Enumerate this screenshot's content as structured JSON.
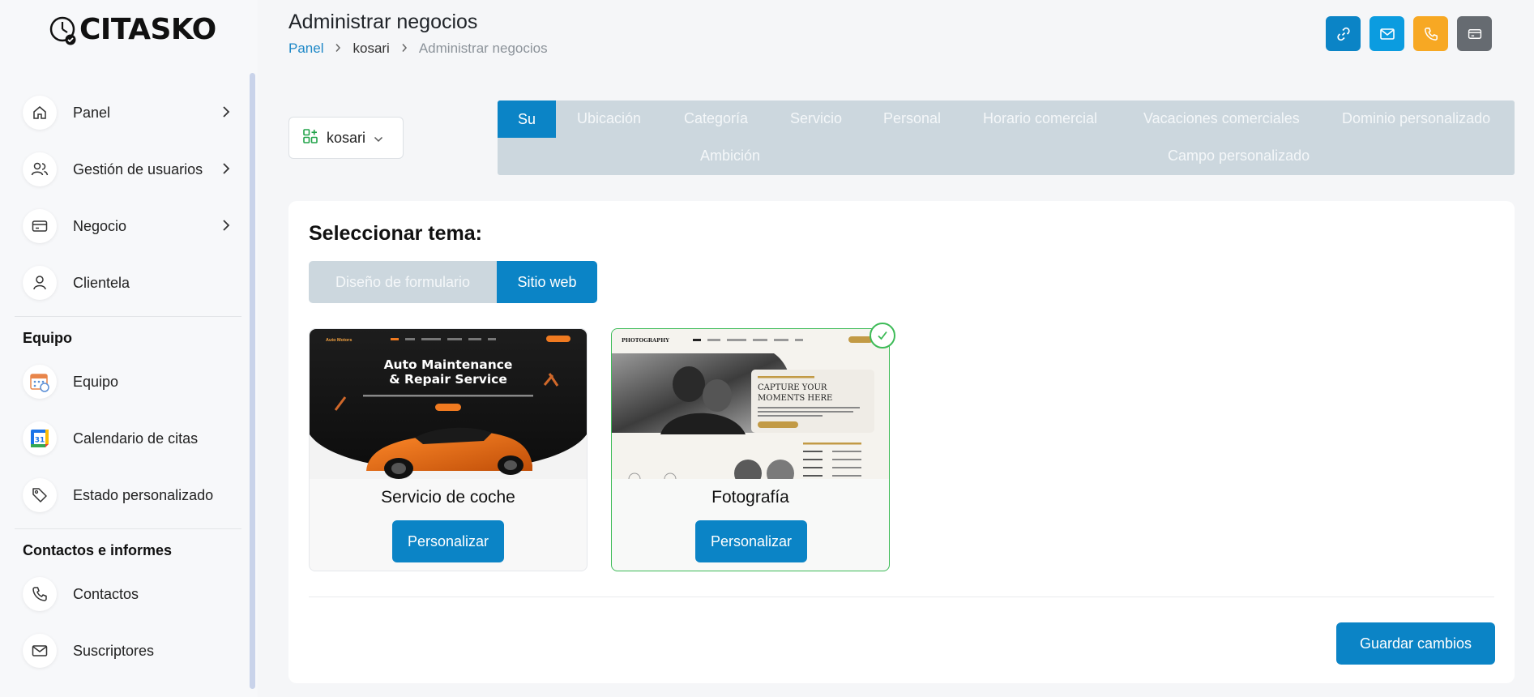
{
  "brand": {
    "name": "CITASKO"
  },
  "header": {
    "title": "Administrar negocios",
    "breadcrumb": [
      "Panel",
      "kosari",
      "Administrar negocios"
    ]
  },
  "top_actions": [
    {
      "icon": "link-icon",
      "color": "#0b84c6"
    },
    {
      "icon": "mail-icon",
      "color": "#0b9ce0"
    },
    {
      "icon": "phone-icon",
      "color": "#f7a823"
    },
    {
      "icon": "card-icon",
      "color": "#666b71"
    }
  ],
  "sidebar": {
    "items": [
      {
        "label": "Panel",
        "icon": "home-icon",
        "chevron": true
      },
      {
        "label": "Gestión de usuarios",
        "icon": "users-icon",
        "chevron": true
      },
      {
        "label": "Negocio",
        "icon": "card-icon",
        "chevron": true
      },
      {
        "label": "Clientela",
        "icon": "user-icon",
        "chevron": false
      }
    ],
    "section_team": "Equipo",
    "team_items": [
      {
        "label": "Equipo",
        "icon": "calendar-team-icon"
      },
      {
        "label": "Calendario de citas",
        "icon": "google-calendar-icon"
      },
      {
        "label": "Estado personalizado",
        "icon": "tag-icon"
      }
    ],
    "section_contacts": "Contactos e informes",
    "contact_items": [
      {
        "label": "Contactos",
        "icon": "phone-icon"
      },
      {
        "label": "Suscriptores",
        "icon": "mail-icon"
      }
    ]
  },
  "business_select": {
    "value": "kosari"
  },
  "tabs": {
    "row1": [
      "Su",
      "Ubicación",
      "Categoría",
      "Servicio",
      "Personal",
      "Horario comercial",
      "Vacaciones comerciales",
      "Dominio personalizado"
    ],
    "row2": [
      "Ambición",
      "Campo personalizado"
    ],
    "active": "Su"
  },
  "theme_section": {
    "title": "Seleccionar tema:",
    "segments": [
      "Diseño de formulario",
      "Sitio web"
    ],
    "active_segment": "Sitio web",
    "themes": [
      {
        "name": "Servicio de coche",
        "button": "Personalizar",
        "selected": false,
        "preview": {
          "brand": "Auto Motors",
          "headline_1": "Auto Maintenance",
          "headline_2": "& Repair Service"
        }
      },
      {
        "name": "Fotografía",
        "button": "Personalizar",
        "selected": true,
        "preview": {
          "brand": "PHOTOGRAPHY",
          "headline_1": "CAPTURE YOUR",
          "headline_2": "MOMENTS HERE"
        }
      }
    ],
    "save_label": "Guardar cambios"
  },
  "colors": {
    "primary": "#0b84c6",
    "tab_bg": "#ccd7de",
    "selected_border": "#3dbb57"
  }
}
